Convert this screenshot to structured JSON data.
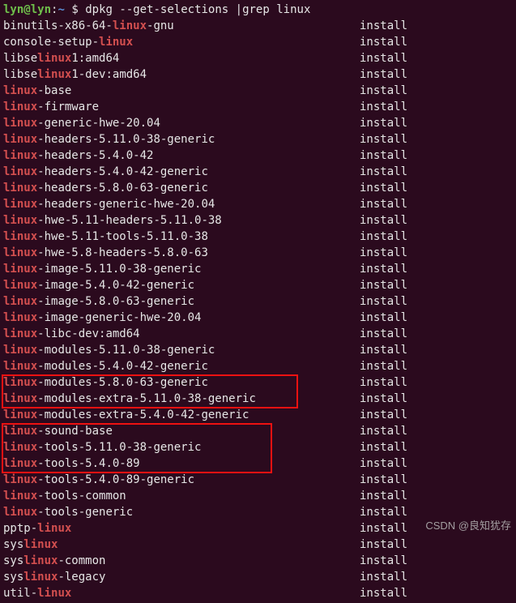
{
  "prompt": {
    "user": "lyn",
    "at": "@",
    "host": "lyn",
    "colon": ":",
    "path": "~",
    "dollar": "$",
    "command": "dpkg --get-selections |grep linux"
  },
  "match": "linux",
  "status": "install",
  "packages": [
    {
      "pre": "binutils-x86-64-",
      "mid": "linux",
      "post": "-gnu"
    },
    {
      "pre": "console-setup-",
      "mid": "linux",
      "post": ""
    },
    {
      "pre": "libse",
      "mid": "linux",
      "post": "1:amd64"
    },
    {
      "pre": "libse",
      "mid": "linux",
      "post": "1-dev:amd64"
    },
    {
      "pre": "",
      "mid": "linux",
      "post": "-base"
    },
    {
      "pre": "",
      "mid": "linux",
      "post": "-firmware"
    },
    {
      "pre": "",
      "mid": "linux",
      "post": "-generic-hwe-20.04"
    },
    {
      "pre": "",
      "mid": "linux",
      "post": "-headers-5.11.0-38-generic"
    },
    {
      "pre": "",
      "mid": "linux",
      "post": "-headers-5.4.0-42"
    },
    {
      "pre": "",
      "mid": "linux",
      "post": "-headers-5.4.0-42-generic"
    },
    {
      "pre": "",
      "mid": "linux",
      "post": "-headers-5.8.0-63-generic"
    },
    {
      "pre": "",
      "mid": "linux",
      "post": "-headers-generic-hwe-20.04"
    },
    {
      "pre": "",
      "mid": "linux",
      "post": "-hwe-5.11-headers-5.11.0-38"
    },
    {
      "pre": "",
      "mid": "linux",
      "post": "-hwe-5.11-tools-5.11.0-38"
    },
    {
      "pre": "",
      "mid": "linux",
      "post": "-hwe-5.8-headers-5.8.0-63"
    },
    {
      "pre": "",
      "mid": "linux",
      "post": "-image-5.11.0-38-generic"
    },
    {
      "pre": "",
      "mid": "linux",
      "post": "-image-5.4.0-42-generic"
    },
    {
      "pre": "",
      "mid": "linux",
      "post": "-image-5.8.0-63-generic"
    },
    {
      "pre": "",
      "mid": "linux",
      "post": "-image-generic-hwe-20.04"
    },
    {
      "pre": "",
      "mid": "linux",
      "post": "-libc-dev:amd64"
    },
    {
      "pre": "",
      "mid": "linux",
      "post": "-modules-5.11.0-38-generic"
    },
    {
      "pre": "",
      "mid": "linux",
      "post": "-modules-5.4.0-42-generic"
    },
    {
      "pre": "",
      "mid": "linux",
      "post": "-modules-5.8.0-63-generic"
    },
    {
      "pre": "",
      "mid": "linux",
      "post": "-modules-extra-5.11.0-38-generic"
    },
    {
      "pre": "",
      "mid": "linux",
      "post": "-modules-extra-5.4.0-42-generic"
    },
    {
      "pre": "",
      "mid": "linux",
      "post": "-sound-base"
    },
    {
      "pre": "",
      "mid": "linux",
      "post": "-tools-5.11.0-38-generic"
    },
    {
      "pre": "",
      "mid": "linux",
      "post": "-tools-5.4.0-89"
    },
    {
      "pre": "",
      "mid": "linux",
      "post": "-tools-5.4.0-89-generic"
    },
    {
      "pre": "",
      "mid": "linux",
      "post": "-tools-common"
    },
    {
      "pre": "",
      "mid": "linux",
      "post": "-tools-generic"
    },
    {
      "pre": "pptp-",
      "mid": "linux",
      "post": ""
    },
    {
      "pre": "sys",
      "mid": "linux",
      "post": ""
    },
    {
      "pre": "sys",
      "mid": "linux",
      "post": "-common"
    },
    {
      "pre": "sys",
      "mid": "linux",
      "post": "-legacy"
    },
    {
      "pre": "util-",
      "mid": "linux",
      "post": ""
    }
  ],
  "watermark": "CSDN @良知犹存"
}
